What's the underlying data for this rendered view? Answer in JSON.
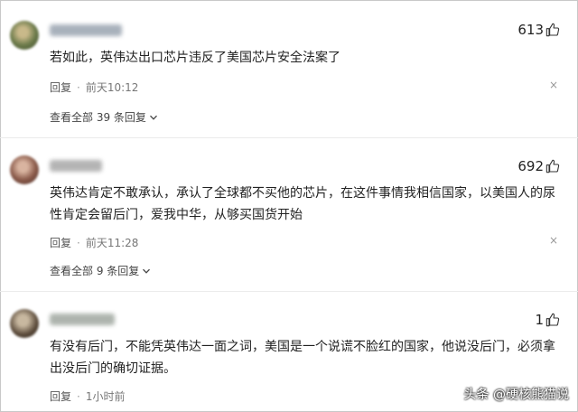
{
  "comments": [
    {
      "username": "用户名已模糊处理",
      "likes": "613",
      "text": "若如此，英伟达出口芯片违反了美国芯片安全法案了",
      "reply_label": "回复",
      "time": "前天10:12",
      "view_replies": "查看全部 39 条回复",
      "avatar_color": "#6b7a4a",
      "username_color": "#9aa4b0"
    },
    {
      "username": "用户名已模糊处理",
      "likes": "692",
      "text": "英伟达肯定不敢承认，承认了全球都不买他的芯片，在这件事情我相信国家，以美国人的尿性肯定会留后门，爱我中华，从够买国货开始",
      "reply_label": "回复",
      "time": "前天11:28",
      "view_replies": "查看全部 9 条回复",
      "avatar_color": "#8a5a4a",
      "username_color": "#a8a8a8"
    },
    {
      "username": "用户名已模糊处理",
      "likes": "1",
      "text": "有没有后门，不能凭英伟达一面之词，美国是一个说谎不脸红的国家，他说没后门，必须拿出没后门的确切证据。",
      "reply_label": "回复",
      "time": "1小时前",
      "avatar_color": "#5a4a3a",
      "username_color": "#a0a8a0"
    }
  ],
  "close_icon": "×",
  "watermark": "头条 @硬核熊猫说"
}
